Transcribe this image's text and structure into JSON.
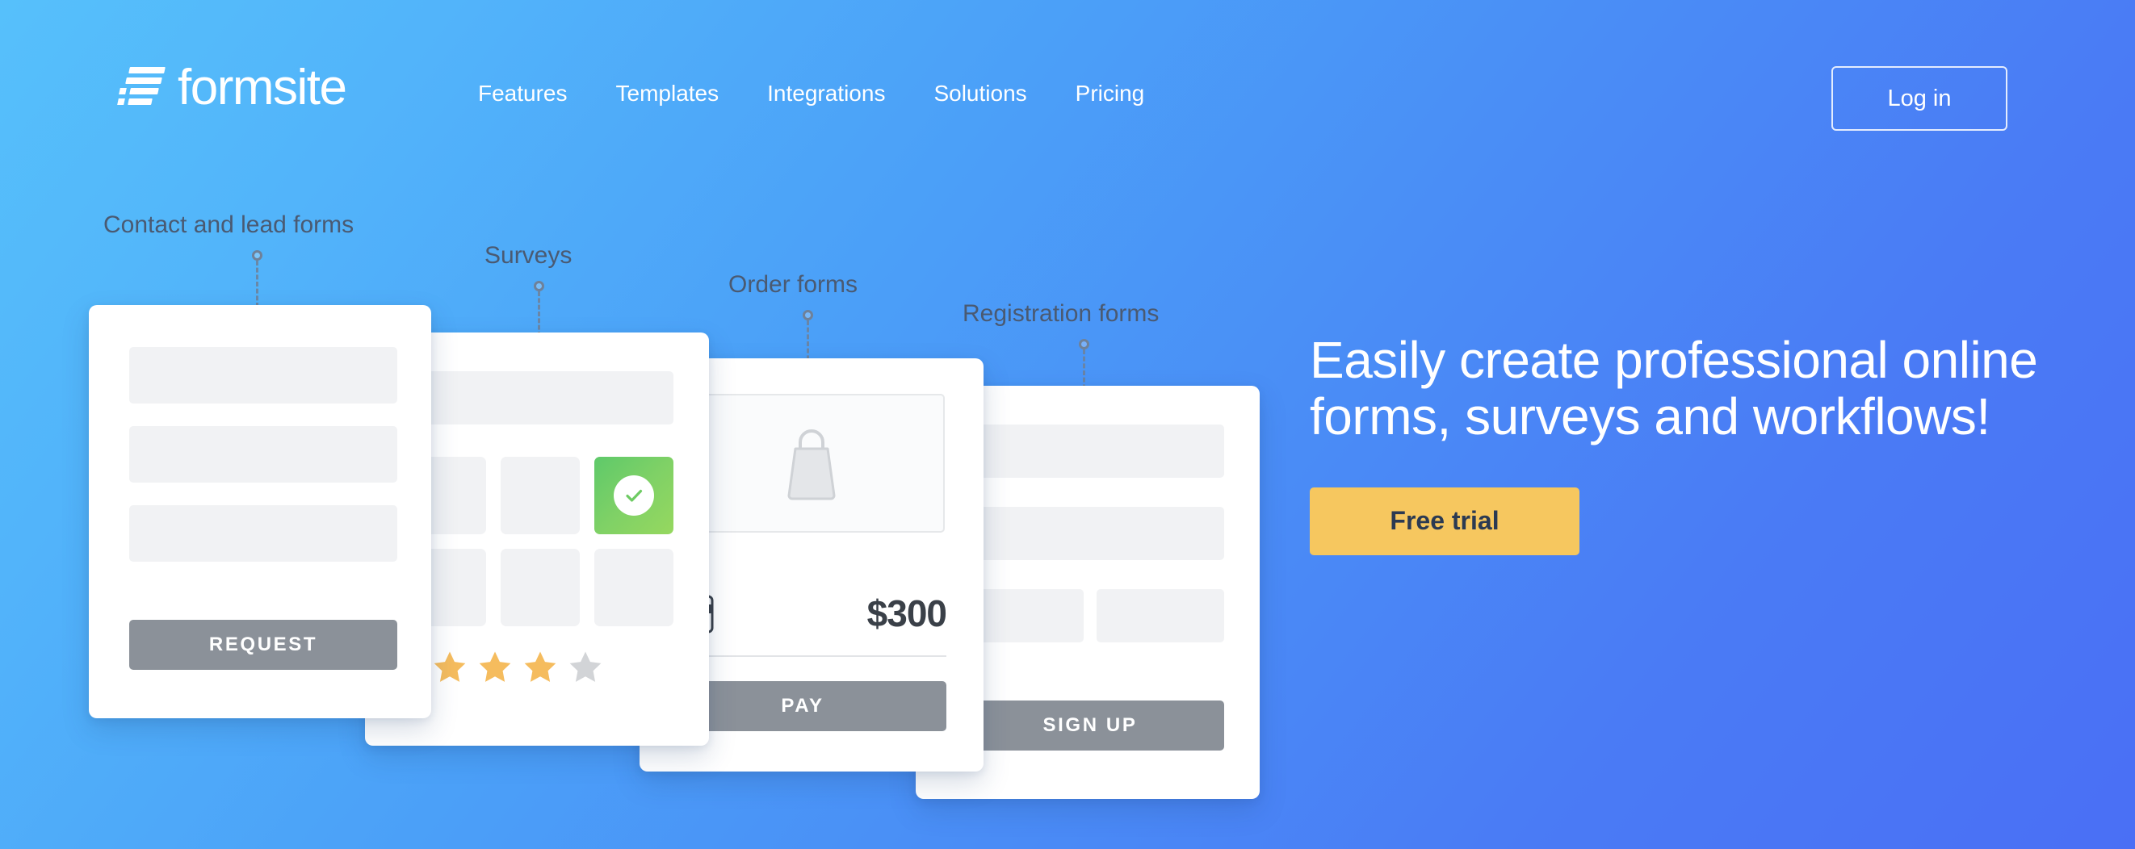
{
  "brand": {
    "name": "formsite",
    "logo_icon": "list-lines-icon"
  },
  "nav": {
    "items": [
      {
        "label": "Features"
      },
      {
        "label": "Templates"
      },
      {
        "label": "Integrations"
      },
      {
        "label": "Solutions"
      },
      {
        "label": "Pricing"
      }
    ],
    "login_label": "Log in"
  },
  "hero": {
    "headline": "Easily create professional online forms, surveys and workflows!",
    "cta_label": "Free trial"
  },
  "callouts": [
    {
      "label": "Contact and lead forms"
    },
    {
      "label": "Surveys"
    },
    {
      "label": "Order forms"
    },
    {
      "label": "Registration forms"
    }
  ],
  "cards": {
    "contact": {
      "button_label": "REQUEST"
    },
    "survey": {
      "button_label": "",
      "stars_filled": 4,
      "stars_total": 5,
      "selected_tile_icon": "check-circle-icon"
    },
    "order": {
      "button_label": "PAY",
      "price": "$300",
      "product_icon": "shopping-bag-icon",
      "payment_icon": "credit-card-icon"
    },
    "registration": {
      "button_label": "SIGN UP"
    }
  },
  "colors": {
    "gradient_start": "#56c0fb",
    "gradient_end": "#4a6ff5",
    "cta_amber": "#F6C75F",
    "cta_text": "#2b3a52",
    "button_gray": "#8b9199",
    "placeholder_gray": "#f1f2f4",
    "star_filled": "#f5bc5e",
    "star_empty": "#d2d4d7",
    "selected_green": "#7fd166",
    "callout_text": "#4a5a72"
  }
}
